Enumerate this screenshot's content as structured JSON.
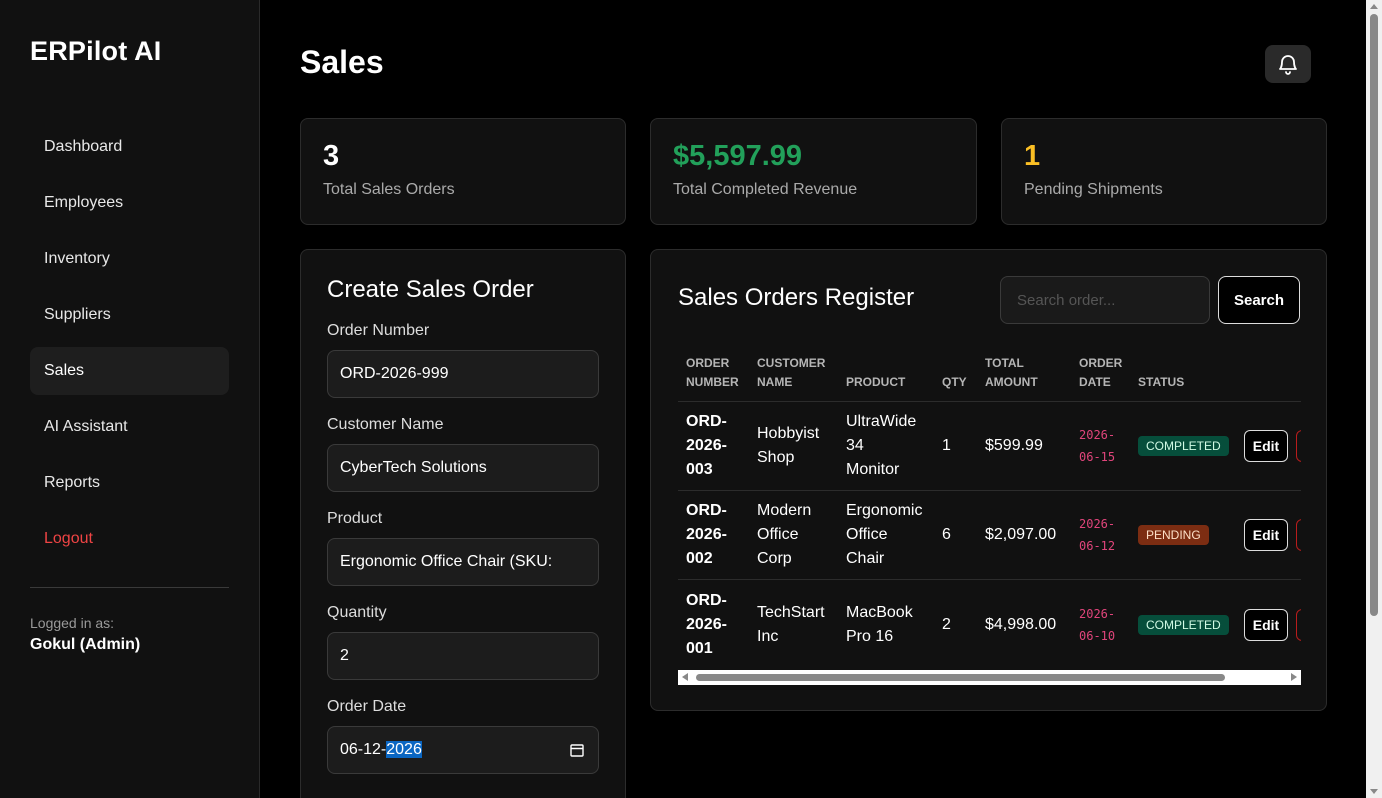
{
  "sidebar": {
    "brand": "ERPilot AI",
    "items": [
      {
        "label": "Dashboard"
      },
      {
        "label": "Employees"
      },
      {
        "label": "Inventory"
      },
      {
        "label": "Suppliers"
      },
      {
        "label": "Sales"
      },
      {
        "label": "AI Assistant"
      },
      {
        "label": "Reports"
      },
      {
        "label": "Logout"
      }
    ],
    "active": "Sales",
    "logged_in_label": "Logged in as:",
    "logged_in_user": "Gokul (Admin)"
  },
  "header": {
    "title": "Sales",
    "bell_icon": "bell-icon"
  },
  "stats": [
    {
      "value": "3",
      "label": "Total Sales Orders",
      "color": "#ffffff"
    },
    {
      "value": "$5,597.99",
      "label": "Total Completed Revenue",
      "color": "#22a05a"
    },
    {
      "value": "1",
      "label": "Pending Shipments",
      "color": "#fbbf24"
    }
  ],
  "form": {
    "title": "Create Sales Order",
    "order_number_label": "Order Number",
    "order_number_value": "ORD-2026-999",
    "customer_label": "Customer Name",
    "customer_value": "CyberTech Solutions",
    "product_label": "Product",
    "product_value": "Ergonomic Office Chair (SKU:",
    "quantity_label": "Quantity",
    "quantity_value": "2",
    "date_label": "Order Date",
    "date_value_prefix": "06-12-",
    "date_value_selected": "2026"
  },
  "register": {
    "title": "Sales Orders Register",
    "search_placeholder": "Search order...",
    "search_button": "Search",
    "columns": {
      "order_number": [
        "ORDER",
        "NUMBER"
      ],
      "customer_name": [
        "CUSTOMER",
        "NAME"
      ],
      "product": "PRODUCT",
      "qty": "QTY",
      "total_amount": [
        "TOTAL",
        "AMOUNT"
      ],
      "order_date": [
        "ORDER",
        "DATE"
      ],
      "status": "STATUS"
    },
    "rows": [
      {
        "order": [
          "ORD-",
          "2026-",
          "003"
        ],
        "customer": [
          "Hobbyist",
          "Shop"
        ],
        "product": [
          "UltraWide",
          "34",
          "Monitor"
        ],
        "qty": "1",
        "total": "$599.99",
        "date": [
          "2026-",
          "06-15"
        ],
        "status": "COMPLETED",
        "edit": "Edit"
      },
      {
        "order": [
          "ORD-",
          "2026-",
          "002"
        ],
        "customer": [
          "Modern",
          "Office",
          "Corp"
        ],
        "product": [
          "Ergonomic",
          "Office",
          "Chair"
        ],
        "qty": "6",
        "total": "$2,097.00",
        "date": [
          "2026-",
          "06-12"
        ],
        "status": "PENDING",
        "edit": "Edit"
      },
      {
        "order": [
          "ORD-",
          "2026-",
          "001"
        ],
        "customer": [
          "TechStart",
          "Inc"
        ],
        "product": [
          "MacBook",
          "Pro 16"
        ],
        "qty": "2",
        "total": "$4,998.00",
        "date": [
          "2026-",
          "06-10"
        ],
        "status": "COMPLETED",
        "edit": "Edit"
      }
    ]
  }
}
